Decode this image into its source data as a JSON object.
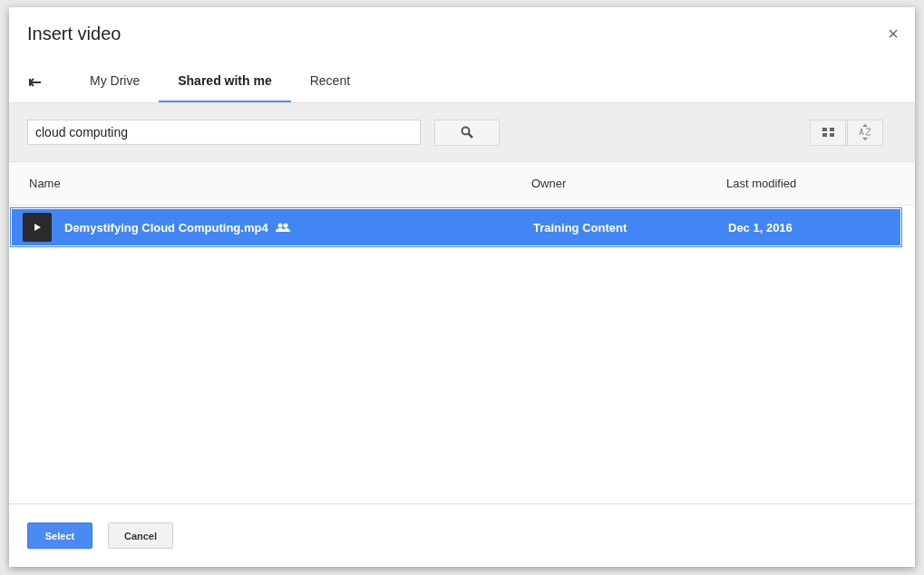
{
  "dialog": {
    "title": "Insert video",
    "close": "×"
  },
  "tabs": [
    {
      "label": "My Drive",
      "selected": false
    },
    {
      "label": "Shared with me",
      "selected": true
    },
    {
      "label": "Recent",
      "selected": false
    }
  ],
  "search": {
    "value": "cloud computing"
  },
  "table": {
    "columns": [
      "Name",
      "Owner",
      "Last modified"
    ],
    "rows": [
      {
        "name": "Demystifying Cloud Computing.mp4",
        "shared": true,
        "owner": "Training Content",
        "modified": "Dec 1, 2016",
        "selected": true
      }
    ]
  },
  "buttons": [
    {
      "label": "Select",
      "kind": "primary"
    },
    {
      "label": "Cancel",
      "kind": "secondary"
    }
  ]
}
